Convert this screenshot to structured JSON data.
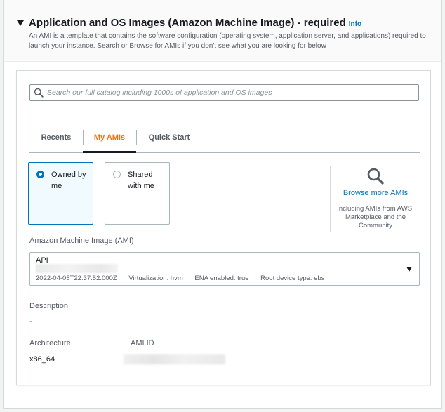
{
  "section": {
    "title": "Application and OS Images (Amazon Machine Image) - required",
    "info_link": "Info",
    "description": "An AMI is a template that contains the software configuration (operating system, application server, and applications) required to launch your instance. Search or Browse for AMIs if you don't see what you are looking for below"
  },
  "search": {
    "placeholder": "Search our full catalog including 1000s of application and OS images",
    "value": ""
  },
  "tabs": [
    {
      "label": "Recents",
      "active": false
    },
    {
      "label": "My AMIs",
      "active": true
    },
    {
      "label": "Quick Start",
      "active": false
    }
  ],
  "ownership": {
    "options": [
      {
        "label": "Owned by me",
        "selected": true
      },
      {
        "label": "Shared with me",
        "selected": false
      }
    ]
  },
  "browse": {
    "link": "Browse more AMIs",
    "subtext": "Including AMIs from AWS, Marketplace and the Community"
  },
  "ami": {
    "label": "Amazon Machine Image (AMI)",
    "name": "API",
    "created": "2022-04-05T22:37:52.000Z",
    "virtualization": "Virtualization: hvm",
    "ena": "ENA enabled: true",
    "root_device": "Root device type: ebs"
  },
  "details": {
    "description_label": "Description",
    "description_value": "-",
    "architecture_label": "Architecture",
    "architecture_value": "x86_64",
    "ami_id_label": "AMI ID"
  },
  "colors": {
    "accent": "#ec7211",
    "link": "#0073bb",
    "border": "#aab7b8"
  }
}
